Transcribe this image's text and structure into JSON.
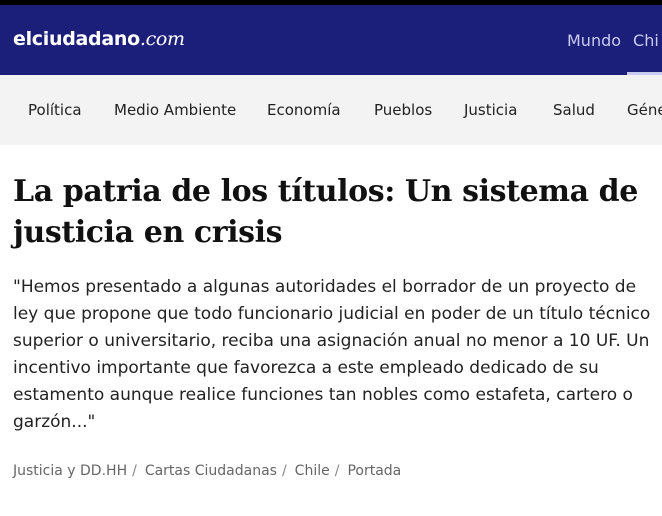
{
  "colors": {
    "header_bg": "#1b1f7a",
    "category_bar_bg": "#f3f3f3",
    "nav_text": "#c9cbf0"
  },
  "header": {
    "logo_main": "elciudadano",
    "logo_domain": ".com",
    "nav": [
      "Mundo",
      "Chi"
    ]
  },
  "categories": [
    "Política",
    "Medio Ambiente",
    "Economía",
    "Pueblos",
    "Justicia",
    "Salud",
    "Géne"
  ],
  "article": {
    "title": "La patria de los títulos: Un sistema de justicia en crisis",
    "lead": "\"Hemos presentado a algunas autoridades el borrador de un proyecto de ley que propone que todo funcionario judicial en poder de un título técnico superior o universitario, reciba una asignación anual no menor a 10 UF. Un incentivo importante que favorezca a este empleado dedicado de su estamento aunque realice funciones tan nobles como estafeta, cartero o garzón...\"",
    "tags": [
      "Justicia y DD.HH",
      "Cartas Ciudadanas",
      "Chile",
      "Portada"
    ],
    "tag_separator": "/"
  }
}
